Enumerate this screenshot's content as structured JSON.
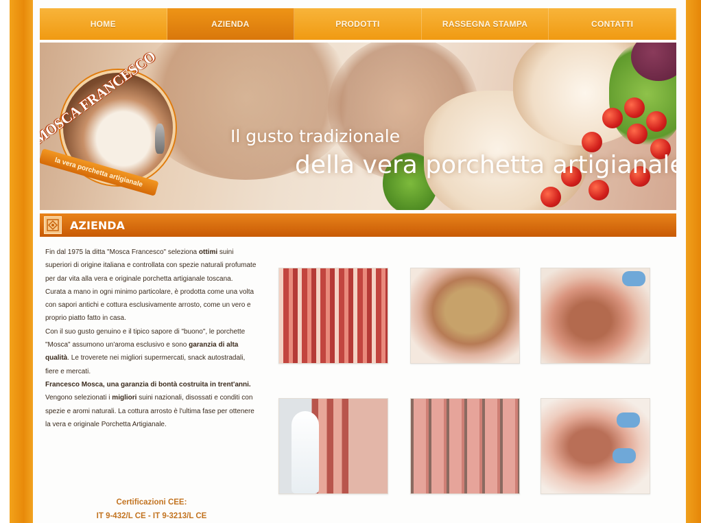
{
  "nav": {
    "items": [
      {
        "label": "HOME",
        "active": false
      },
      {
        "label": "AZIENDA",
        "active": true
      },
      {
        "label": "PRODOTTI",
        "active": false
      },
      {
        "label": "RASSEGNA STAMPA",
        "active": false
      },
      {
        "label": "CONTATTI",
        "active": false
      }
    ]
  },
  "banner": {
    "tagline_line1": "Il gusto tradizionale",
    "tagline_line2": "della vera porchetta artigianale"
  },
  "logo": {
    "name": "MOSCA FRANCESCO",
    "ribbon": "la vera porchetta artigianale"
  },
  "section": {
    "title": "AZIENDA"
  },
  "content": {
    "p1_a": "Fin dal 1975 la ditta \"Mosca Francesco\" seleziona ",
    "p1_b": "ottimi",
    "p1_c": " suini superiori di origine italiana e controllata con spezie naturali profumate per dar vita alla vera e originale porchetta artigianale toscana.",
    "p2": "Curata a mano in ogni minimo particolare, è prodotta come una volta con sapori antichi e cottura esclusivamente arrosto, come un vero e proprio piatto fatto in casa.",
    "p3_a": "Con il suo gusto genuino e il tipico sapore di \"buono\", le porchette \"Mosca\" assumono un'aroma esclusivo e sono ",
    "p3_b": "garanzia di alta qualità",
    "p3_c": ". Le troverete nei migliori supermercati, snack autostradali, fiere e mercati.",
    "p4": "Francesco Mosca, una garanzia di bontà costruita in trent'anni.",
    "p5_a": "Vengono selezionati i ",
    "p5_b": "migliori",
    "p5_c": " suini nazionali, disossati e conditi con spezie e aromi naturali. La cottura arrosto è l'ultima fase per ottenere la vera e originale Porchetta Artigianale."
  },
  "certifications": {
    "title": "Certificazioni CEE:",
    "codes": "IT 9-432/L CE - IT 9-3213/L CE"
  },
  "colors": {
    "brand_orange": "#f09a12",
    "header_orange": "#c85a05",
    "cert_text": "#c27320"
  }
}
